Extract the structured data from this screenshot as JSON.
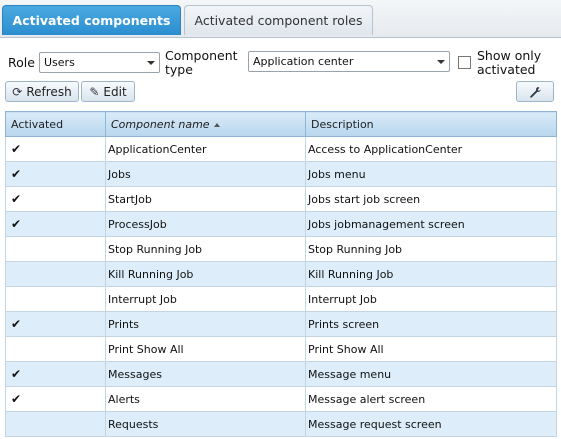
{
  "tabs": [
    {
      "label": "Activated components",
      "active": true
    },
    {
      "label": "Activated component roles",
      "active": false
    }
  ],
  "filters": {
    "role_label": "Role",
    "role_value": "Users",
    "component_type_label_1": "Component",
    "component_type_label_2": "type",
    "component_type_value": "Application center",
    "show_only_label_1": "Show only",
    "show_only_label_2": "activated",
    "show_only_checked": false
  },
  "toolbar": {
    "refresh_label": "Refresh",
    "edit_label": "Edit",
    "refresh_icon": "refresh-icon",
    "edit_icon": "pencil-icon",
    "settings_icon": "wrench-icon"
  },
  "grid": {
    "columns": [
      "Activated",
      "Component name",
      "Description"
    ],
    "sorted_column": "Component name",
    "sort_direction": "ascending",
    "rows": [
      {
        "activated": true,
        "name": "ApplicationCenter",
        "description": "Access to ApplicationCenter"
      },
      {
        "activated": true,
        "name": "Jobs",
        "description": "Jobs menu"
      },
      {
        "activated": true,
        "name": "StartJob",
        "description": "Jobs start job screen"
      },
      {
        "activated": true,
        "name": "ProcessJob",
        "description": "Jobs jobmanagement screen"
      },
      {
        "activated": false,
        "name": "Stop Running Job",
        "description": "Stop Running Job"
      },
      {
        "activated": false,
        "name": "Kill Running Job",
        "description": "Kill Running Job"
      },
      {
        "activated": false,
        "name": "Interrupt Job",
        "description": "Interrupt Job"
      },
      {
        "activated": true,
        "name": "Prints",
        "description": "Prints screen"
      },
      {
        "activated": false,
        "name": "Print Show All",
        "description": "Print Show All"
      },
      {
        "activated": true,
        "name": "Messages",
        "description": "Message menu"
      },
      {
        "activated": true,
        "name": "Alerts",
        "description": "Message alert screen"
      },
      {
        "activated": false,
        "name": "Requests",
        "description": "Message request screen"
      }
    ]
  },
  "colors": {
    "active_tab": "#2b8ed0",
    "alt_row": "#ddeefa",
    "header": "#b8d6ee"
  }
}
